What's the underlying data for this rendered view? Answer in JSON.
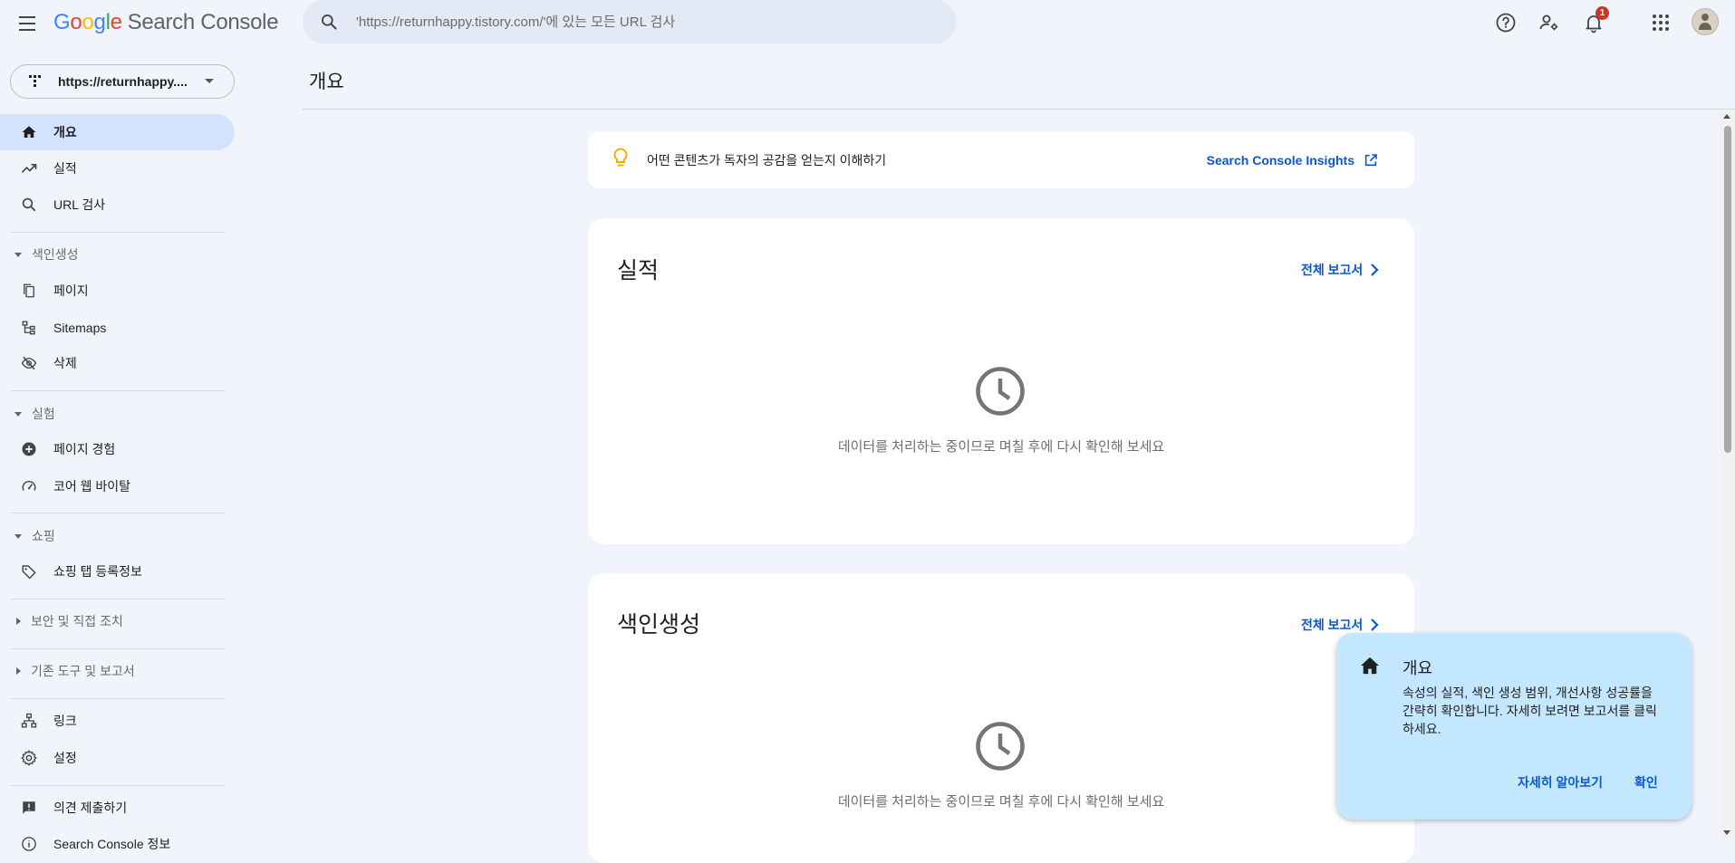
{
  "header": {
    "logo_letters": [
      "G",
      "o",
      "o",
      "g",
      "l",
      "e"
    ],
    "logo_product": "Search Console",
    "search_placeholder": "'https://returnhappy.tistory.com/'에 있는 모든 URL 검사",
    "notification_count": "1",
    "icons": [
      "menu-icon",
      "search-icon",
      "help-icon",
      "manage-users-icon",
      "bell-icon",
      "apps-grid-icon",
      "avatar"
    ]
  },
  "property": {
    "label": "https://returnhappy...."
  },
  "sidebar": {
    "top_items": [
      {
        "label": "개요",
        "icon": "home-icon",
        "active": true
      },
      {
        "label": "실적",
        "icon": "trending-up-icon"
      },
      {
        "label": "URL 검사",
        "icon": "search-icon"
      }
    ],
    "sections": [
      {
        "title": "색인생성",
        "expanded": true,
        "items": [
          {
            "label": "페이지",
            "icon": "pages-icon"
          },
          {
            "label": "Sitemaps",
            "icon": "sitemap-icon"
          },
          {
            "label": "삭제",
            "icon": "visibility-off-icon"
          }
        ]
      },
      {
        "title": "실험",
        "expanded": true,
        "items": [
          {
            "label": "페이지 경험",
            "icon": "add-circle-icon"
          },
          {
            "label": "코어 웹 바이탈",
            "icon": "speed-gauge-icon"
          }
        ]
      },
      {
        "title": "쇼핑",
        "expanded": true,
        "items": [
          {
            "label": "쇼핑 탭 등록정보",
            "icon": "tag-icon"
          }
        ]
      },
      {
        "title": "보안 및 직접 조치",
        "expanded": false,
        "items": []
      },
      {
        "title": "기존 도구 및 보고서",
        "expanded": false,
        "items": []
      }
    ],
    "bottom_items": [
      {
        "label": "링크",
        "icon": "links-icon"
      },
      {
        "label": "설정",
        "icon": "gear-icon"
      }
    ],
    "footer_items": [
      {
        "label": "의견 제출하기",
        "icon": "feedback-icon"
      },
      {
        "label": "Search Console 정보",
        "icon": "info-icon"
      }
    ]
  },
  "main": {
    "title": "개요",
    "insight": {
      "text": "어떤 콘텐츠가 독자의 공감을 얻는지 이해하기",
      "link": "Search Console Insights",
      "icon": "lightbulb-icon",
      "link_icon": "open-in-new-icon"
    },
    "cards": [
      {
        "title": "실적",
        "link": "전체 보고서",
        "message": "데이터를 처리하는 중이므로 며칠 후에 다시 확인해 보세요",
        "icon": "clock-icon"
      },
      {
        "title": "색인생성",
        "link": "전체 보고서",
        "message": "데이터를 처리하는 중이므로 며칠 후에 다시 확인해 보세요",
        "icon": "clock-icon"
      }
    ]
  },
  "tooltip": {
    "title": "개요",
    "body": "속성의 실적, 색인 생성 범위, 개선사항 성공률을 간략히 확인합니다. 자세히 보려면 보고서를 클릭하세요.",
    "learn_more": "자세히 알아보기",
    "confirm": "확인",
    "icon": "home-icon"
  },
  "colors": {
    "background": "#f1f4fb",
    "active_nav": "#d3e3fd",
    "link": "#0b57d0",
    "tooltip_bg": "#c2e7ff",
    "badge": "#d93025",
    "bulb": "#f9ab00"
  }
}
